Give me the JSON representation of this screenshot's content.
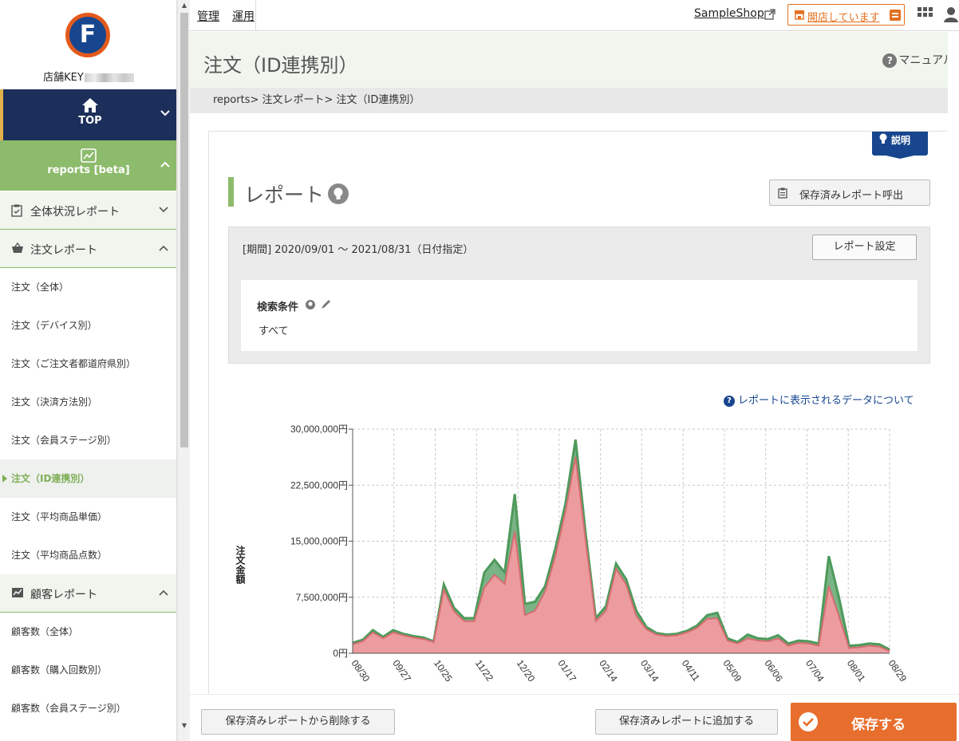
{
  "sidebar": {
    "shop_key_label": "店舗KEY",
    "top_label": "TOP",
    "reports_label": "reports [beta]",
    "groups": [
      {
        "label": "全体状況レポート",
        "icon": "clipboard-check-icon",
        "expanded": false
      },
      {
        "label": "注文レポート",
        "icon": "basket-icon",
        "expanded": true
      },
      {
        "label": "顧客レポート",
        "icon": "customer-chart-icon",
        "expanded": true
      }
    ],
    "order_items": [
      {
        "label": "注文（全体）",
        "active": false
      },
      {
        "label": "注文（デバイス別）",
        "active": false
      },
      {
        "label": "注文（ご注文者都道府県別）",
        "active": false
      },
      {
        "label": "注文（決済方法別）",
        "active": false
      },
      {
        "label": "注文（会員ステージ別）",
        "active": false
      },
      {
        "label": "注文（ID連携別）",
        "active": true
      },
      {
        "label": "注文（平均商品単価）",
        "active": false
      },
      {
        "label": "注文（平均商品点数）",
        "active": false
      }
    ],
    "customer_items": [
      {
        "label": "顧客数（全体）"
      },
      {
        "label": "顧客数（購入回数別）"
      },
      {
        "label": "顧客数（会員ステージ別）"
      }
    ]
  },
  "topbar": {
    "manage": "管理",
    "operate": "運用",
    "shop_name": "SampleShop",
    "open_status": "開店しています"
  },
  "page": {
    "title": "注文（ID連携別）",
    "manual": "マニュアル",
    "breadcrumb": "reports> 注文レポート> 注文（ID連携別）"
  },
  "report": {
    "explain_badge": "説明",
    "heading": "レポート",
    "saved_call": "保存済みレポート呼出",
    "period": "[期間] 2020/09/01 ～ 2021/08/31（日付指定）",
    "settings": "レポート設定",
    "condition_label": "検索条件",
    "condition_value": "すべて",
    "data_note": "レポートに表示されるデータについて"
  },
  "bottom": {
    "delete_saved": "保存済みレポートから削除する",
    "add_saved": "保存済みレポートに追加する",
    "save": "保存する"
  },
  "colors": {
    "navy": "#1c2e5a",
    "green": "#8dbb6c",
    "series_green": "#4e9a5c",
    "series_red": "#ec9c9f",
    "orange": "#e86e2d"
  },
  "chart_data": {
    "type": "area",
    "ylabel": "注文金額",
    "ylim": [
      0,
      30000000
    ],
    "yticks": [
      0,
      7500000,
      15000000,
      22500000,
      30000000
    ],
    "ytick_labels": [
      "0円",
      "7,500,000円",
      "15,000,000円",
      "22,500,000円",
      "30,000,000円"
    ],
    "xtick_labels": [
      "08/30",
      "09/27",
      "10/25",
      "11/22",
      "12/20",
      "01/17",
      "02/14",
      "03/14",
      "04/11",
      "05/09",
      "06/06",
      "07/04",
      "08/01",
      "08/29"
    ],
    "grid": true,
    "stacked": true,
    "series": [
      {
        "color": "#ec9c9f",
        "values": [
          1200000,
          1600000,
          2800000,
          2000000,
          2800000,
          2400000,
          2100000,
          1900000,
          1500000,
          8500000,
          5600000,
          4300000,
          4300000,
          8800000,
          10500000,
          9300000,
          16300000,
          5100000,
          5700000,
          8300000,
          13000000,
          19000000,
          26300000,
          15000000,
          4300000,
          5700000,
          11300000,
          9200000,
          5000000,
          3200000,
          2500000,
          2300000,
          2400000,
          2800000,
          3400000,
          4600000,
          4700000,
          1700000,
          1300000,
          2000000,
          1700000,
          1600000,
          2000000,
          1000000,
          1400000,
          1300000,
          1000000,
          9000000,
          5000000,
          700000,
          800000,
          1000000,
          900000,
          300000
        ]
      },
      {
        "color": "#4e9a5c",
        "values": [
          200000,
          200000,
          300000,
          200000,
          300000,
          200000,
          200000,
          200000,
          100000,
          700000,
          500000,
          400000,
          400000,
          2000000,
          2000000,
          1500000,
          5000000,
          1500000,
          1200000,
          700000,
          1000000,
          1000000,
          2300000,
          1000000,
          400000,
          600000,
          700000,
          700000,
          700000,
          300000,
          200000,
          200000,
          200000,
          200000,
          300000,
          500000,
          700000,
          300000,
          200000,
          500000,
          300000,
          300000,
          400000,
          300000,
          300000,
          300000,
          300000,
          4000000,
          2500000,
          300000,
          300000,
          300000,
          300000,
          200000
        ]
      }
    ]
  }
}
